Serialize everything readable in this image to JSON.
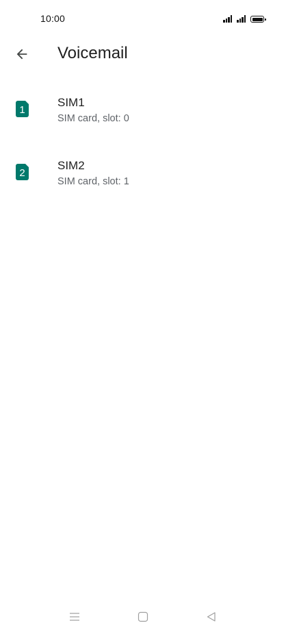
{
  "status_bar": {
    "time": "10:00"
  },
  "header": {
    "title": "Voicemail",
    "back_icon": "arrow-left-icon"
  },
  "sims": [
    {
      "name": "SIM1",
      "subtitle": "SIM card, slot: 0",
      "badge": "1"
    },
    {
      "name": "SIM2",
      "subtitle": "SIM card, slot: 1",
      "badge": "2"
    }
  ],
  "colors": {
    "sim_badge": "#00796b",
    "text_primary": "#1f1f1f",
    "text_secondary": "#5f6368"
  },
  "nav_bar": {
    "icons": [
      "menu-icon",
      "home-icon",
      "back-triangle-icon"
    ]
  }
}
